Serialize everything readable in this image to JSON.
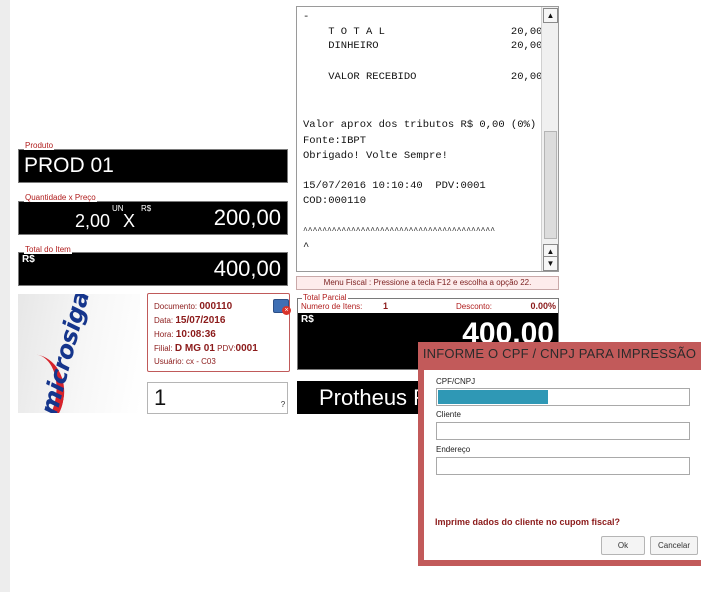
{
  "receipt": {
    "lines": [
      "-",
      "    T O T A L                    20,00",
      "    DINHEIRO                     20,00",
      "",
      "    VALOR RECEBIDO               20,00",
      "",
      "",
      "",
      "Valor aprox dos tributos R$ 0,00 (0%)",
      "Fonte:IBPT",
      "Obrigado! Volte Sempre!",
      "",
      "15/07/2016 10:10:40  PDV:0001",
      "COD:000110",
      "",
      "^^^^^^^^^^^^^^^^^^^^^^^^^^^^^^^^^^^^^^^^",
      "^"
    ],
    "scroll_up": "▲",
    "scroll_down_top": "▲",
    "scroll_down": "▼"
  },
  "menu_fiscal": "Menu Fiscal : Pressione a tecla F12 e escolha a opção 22.",
  "produto": {
    "label": "Produto",
    "value": "PROD 01"
  },
  "quantidade": {
    "label": "Quantidade x Preço",
    "qty": "2,00",
    "unit": "UN",
    "x": "X",
    "currency": "R$",
    "price": "200,00"
  },
  "total_item": {
    "label": "Total do Item",
    "currency": "R$",
    "value": "400,00"
  },
  "logo": {
    "text": "microsiga"
  },
  "doc": {
    "documento_label": "Documento:",
    "documento": "000110",
    "data_label": "Data:",
    "data": "15/07/2016",
    "hora_label": "Hora:",
    "hora": "10:08:36",
    "filial_label": "Filial:",
    "filial": "D MG 01",
    "pdv_label": "PDV:",
    "pdv": "0001",
    "usuario_label": "Usuário:",
    "usuario": "cx - C03"
  },
  "qty_input": {
    "value": "1",
    "help": "?"
  },
  "total_parcial": {
    "label": "Total Parcial",
    "itens_label": "Numero de Itens:",
    "itens": "1",
    "desconto_label": "Desconto:",
    "desconto": "0.00%",
    "currency": "R$",
    "value": "400,00"
  },
  "protheus": "Protheus F",
  "dialog": {
    "title": "INFORME O CPF / CNPJ PARA IMPRESSÃO",
    "cpf_label": "CPF/CNPJ",
    "cliente_label": "Cliente",
    "endereco_label": "Endereço",
    "question": "Imprime dados do cliente no cupom fiscal?",
    "ok": "Ok",
    "cancel": "Cancelar"
  }
}
